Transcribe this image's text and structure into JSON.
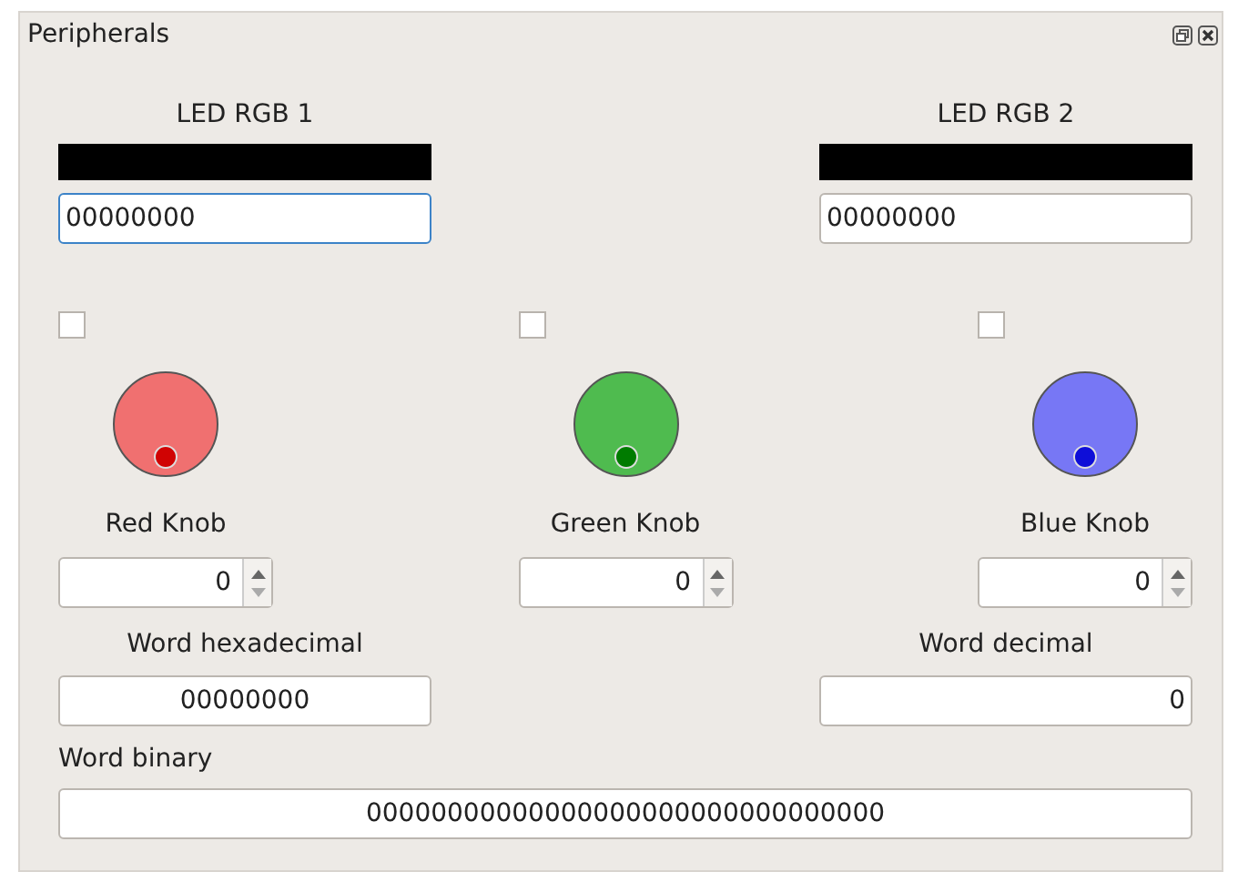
{
  "window": {
    "title": "Peripherals"
  },
  "leds": [
    {
      "label": "LED RGB 1",
      "color": "#000000",
      "value": "00000000",
      "focused": true
    },
    {
      "label": "LED RGB 2",
      "color": "#000000",
      "value": "00000000",
      "focused": false
    }
  ],
  "knobs": [
    {
      "label": "Red Knob",
      "color": "#f07070",
      "checked": false,
      "value": "0"
    },
    {
      "label": "Green Knob",
      "color": "#4fbb4f",
      "checked": false,
      "value": "0"
    },
    {
      "label": "Blue Knob",
      "color": "#7777f5",
      "checked": false,
      "value": "0"
    }
  ],
  "word_hexadecimal": {
    "label": "Word hexadecimal",
    "value": "00000000"
  },
  "word_decimal": {
    "label": "Word decimal",
    "value": "0"
  },
  "word_binary": {
    "label": "Word binary",
    "value": "00000000000000000000000000000000"
  }
}
